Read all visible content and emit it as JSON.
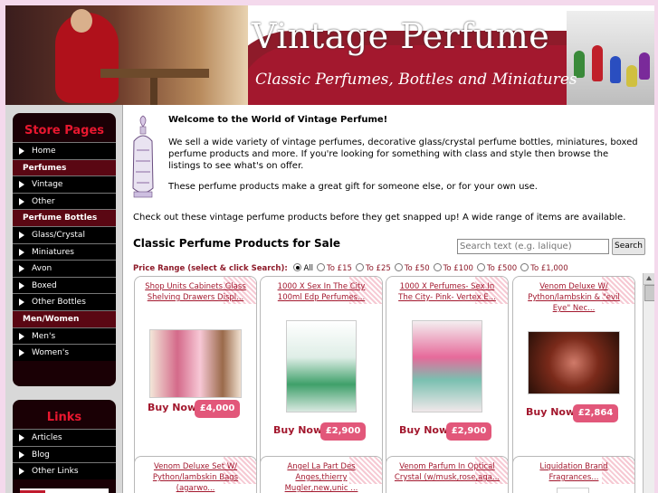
{
  "banner": {
    "title": "Vintage Perfume",
    "subtitle": "Classic Perfumes, Bottles and Miniatures"
  },
  "sidebar": {
    "store_title": "Store Pages",
    "store_items": [
      {
        "label": "Home",
        "type": "item"
      },
      {
        "label": "Perfumes",
        "type": "category"
      },
      {
        "label": "Vintage",
        "type": "item"
      },
      {
        "label": "Other",
        "type": "item"
      },
      {
        "label": "Perfume Bottles",
        "type": "category"
      },
      {
        "label": "Glass/Crystal",
        "type": "item"
      },
      {
        "label": "Miniatures",
        "type": "item"
      },
      {
        "label": "Avon",
        "type": "item"
      },
      {
        "label": "Boxed",
        "type": "item"
      },
      {
        "label": "Other Bottles",
        "type": "item"
      },
      {
        "label": "Men/Women",
        "type": "category"
      },
      {
        "label": "Men's",
        "type": "item"
      },
      {
        "label": "Women's",
        "type": "item"
      }
    ],
    "links_title": "Links",
    "link_items": [
      {
        "label": "Articles"
      },
      {
        "label": "Blog"
      },
      {
        "label": "Other Links"
      }
    ]
  },
  "main": {
    "welcome_title": "Welcome to the World of Vintage Perfume!",
    "para1": "We sell a wide variety of vintage perfumes, decorative glass/crystal perfume bottles, miniatures, boxed perfume products and more.  If you're looking for something with class and style then browse the listings to see what's on offer.",
    "para2": "These perfume products make a great gift for someone else, or for your own use.",
    "checkout": "Check out these vintage perfume products before they get snapped up!  A wide range of items are available.",
    "section_title": "Classic Perfume Products for Sale",
    "search": {
      "placeholder": "Search text (e.g. lalique)",
      "button": "Search"
    },
    "price_range": {
      "label": "Price Range (select & click Search):",
      "options": [
        "All",
        "To £15",
        "To £25",
        "To £50",
        "To £100",
        "To £500",
        "To £1,000"
      ],
      "selected": "All"
    },
    "buy_label": "Buy Now",
    "products_row1": [
      {
        "title": "Shop Units Cabinets Glass Shelving Drawers Displ...",
        "price": "£4,000"
      },
      {
        "title": "1000 X Sex In The City 100ml Edp Perfumes...",
        "price": "£2,900"
      },
      {
        "title": "1000 X Perfumes- Sex In The City- Pink- Vertex E...",
        "price": "£2,900"
      },
      {
        "title": "Venom Deluxe W/ Python/lambskin & \"evil Eye\" Nec...",
        "price": "£2,864"
      }
    ],
    "products_row2": [
      {
        "title": "Venom Deluxe Set W/ Python/lambskin Bags (agarwo..."
      },
      {
        "title": "Angel La Part Des Anges,thierry Mugler,new,unic ..."
      },
      {
        "title": "Venom Parfum In Optical Crystal (w/musk,rose,aga..."
      },
      {
        "title": "Liquidation Brand Fragrances..."
      }
    ]
  },
  "colors": {
    "brand_red": "#a3182e",
    "price_pink": "#e2577a",
    "nav_black": "#000000",
    "nav_category": "#5a0713"
  }
}
